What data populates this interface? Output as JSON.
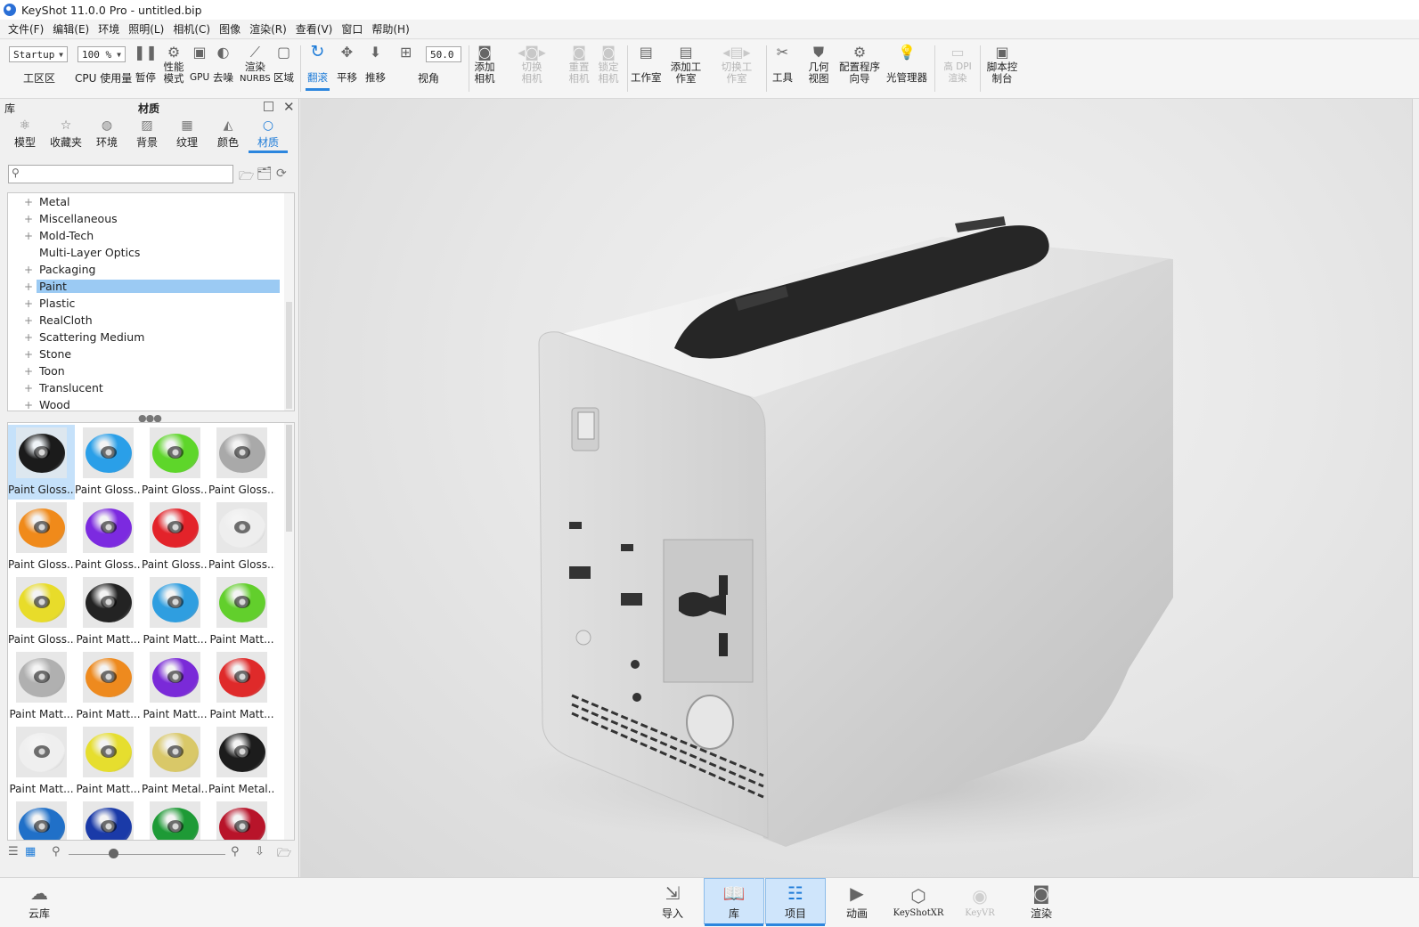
{
  "window": {
    "title": "KeyShot 11.0.0 Pro  - untitled.bip"
  },
  "menu": [
    "文件(F)",
    "编辑(E)",
    "环境",
    "照明(L)",
    "相机(C)",
    "图像",
    "渲染(R)",
    "查看(V)",
    "窗口",
    "帮助(H)"
  ],
  "toolbar": {
    "workspace_value": "Startup",
    "workspace_label": "工区区",
    "cpu_value": "100 %",
    "cpu_label": "CPU 使用量",
    "pause_label": "暂停",
    "perf_label": "性能模式",
    "gpu_label": "GPU",
    "denoise_label": "去噪",
    "nurbs_label_1": "渲染",
    "nurbs_label_2": "NURBS",
    "region_label": "区域",
    "tumble_label": "翻滚",
    "pan_label": "平移",
    "dolly_label": "推移",
    "fov_value": "50.0",
    "fov_label": "视角",
    "add_camera_label": "添加相机",
    "switch_camera_label": "切换相机",
    "reset_camera_label": "重置相机",
    "lock_camera_label": "锁定相机",
    "studio_label": "工作室",
    "add_studio_label": "添加工作室",
    "switch_studio_label": "切换工作室",
    "tools_label": "工具",
    "geometry_view_label": "几何视图",
    "config_wizard_label": "配置程序向导",
    "light_manager_label": "光管理器",
    "high_dpi_label": "高 DPI 渲染",
    "script_console_label": "脚本控制台"
  },
  "library": {
    "header_label": "库",
    "panel_title": "材质",
    "tabs": [
      "模型",
      "收藏夹",
      "环境",
      "背景",
      "纹理",
      "颜色",
      "材质"
    ],
    "search_placeholder": "",
    "tree": [
      "Metal",
      "Miscellaneous",
      "Mold-Tech",
      "Multi-Layer Optics",
      "Packaging",
      "Paint",
      "Plastic",
      "RealCloth",
      "Scattering Medium",
      "Stone",
      "Toon",
      "Translucent",
      "Wood"
    ],
    "selected_tree_item": "Paint",
    "materials": [
      {
        "name": "Paint Gloss...",
        "color": "#1b1b1b"
      },
      {
        "name": "Paint Gloss...",
        "color": "#2a9fe8"
      },
      {
        "name": "Paint Gloss...",
        "color": "#5ed62a"
      },
      {
        "name": "Paint Gloss...",
        "color": "#a9a9a9"
      },
      {
        "name": "Paint Gloss...",
        "color": "#f08a1a"
      },
      {
        "name": "Paint Gloss...",
        "color": "#7c2ae0"
      },
      {
        "name": "Paint Gloss...",
        "color": "#e3232a"
      },
      {
        "name": "Paint Gloss...",
        "color": "#eeeeee"
      },
      {
        "name": "Paint Gloss...",
        "color": "#e8dc2a"
      },
      {
        "name": "Paint Matt...",
        "color": "#232323"
      },
      {
        "name": "Paint Matt...",
        "color": "#2f9ee0"
      },
      {
        "name": "Paint Matt...",
        "color": "#62cf2c"
      },
      {
        "name": "Paint Matt...",
        "color": "#b0b0b0"
      },
      {
        "name": "Paint Matt...",
        "color": "#ee8a1e"
      },
      {
        "name": "Paint Matt...",
        "color": "#7a2ad8"
      },
      {
        "name": "Paint Matt...",
        "color": "#df2a2a"
      },
      {
        "name": "Paint Matt...",
        "color": "#efefef"
      },
      {
        "name": "Paint Matt...",
        "color": "#e6de2e"
      },
      {
        "name": "Paint Metal...",
        "color": "#d9c868"
      },
      {
        "name": "Paint Metal...",
        "color": "#1c1c1c"
      },
      {
        "name": "",
        "color": "#2070c8"
      },
      {
        "name": "",
        "color": "#1a3aa8"
      },
      {
        "name": "",
        "color": "#1e9a36"
      },
      {
        "name": "",
        "color": "#b8142a"
      }
    ]
  },
  "bottombar": {
    "cloud_label": "云库",
    "import_label": "导入",
    "library_label": "库",
    "project_label": "项目",
    "animation_label": "动画",
    "keyshotxr_label": "KeyShotXR",
    "keyvr_label": "KeyVR",
    "render_label": "渲染"
  },
  "colors": {
    "accent": "#2c86de",
    "selection": "#9bcaf3"
  }
}
